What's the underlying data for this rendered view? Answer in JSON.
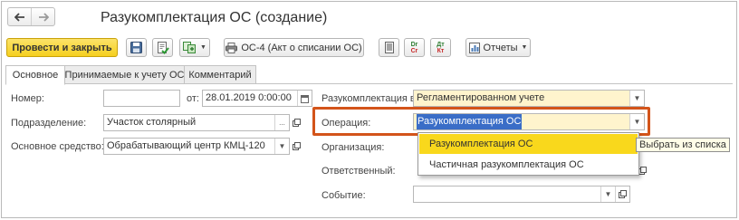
{
  "window": {
    "title": "Разукомплектация ОС (создание)"
  },
  "nav": {
    "back_icon": "arrow-left-icon",
    "forward_icon": "arrow-right-icon"
  },
  "toolbar": {
    "post_close_label": "Провести и закрыть",
    "save_icon": "floppy-disk-icon",
    "post_icon": "post-document-icon",
    "create_based_icon": "create-based-on-icon",
    "print_form_label": "ОС-4 (Акт о списании ОС)",
    "journal_icon": "journal-icon",
    "dt_kt_glyph": {
      "top": "Dr",
      "bottom": "Cr"
    },
    "dt_kt_ru_glyph": {
      "top": "Дт",
      "bottom": "Кт"
    },
    "reports_label": "Отчеты"
  },
  "tabs": [
    {
      "label": "Основное"
    },
    {
      "label": "Принимаемые к учету ОС"
    },
    {
      "label": "Комментарий"
    }
  ],
  "form": {
    "number_label": "Номер:",
    "number_value": "",
    "date_label": "от:",
    "date_value": "28.01.2019  0:00:00",
    "department_label": "Подразделение:",
    "department_value": "Участок столярный",
    "asset_label": "Основное средство:",
    "asset_value": "Обрабатывающий центр КМЦ-120",
    "disassembly_in_label": "Разукомплектация в:",
    "disassembly_in_value": "Регламентированном учете",
    "operation_label": "Операция:",
    "operation_value": "Разукомплектация ОС",
    "organization_label": "Организация:",
    "responsible_label": "Ответственный:",
    "event_label": "Событие:",
    "event_value": ""
  },
  "dropdown": {
    "items": [
      {
        "label": "Разукомплектация ОС"
      },
      {
        "label": "Частичная разукомплектация ОС"
      }
    ],
    "tooltip": "Выбрать из списка"
  },
  "colors": {
    "primary_button": "#f5cf1f",
    "highlight_border": "#d3541a",
    "selected_item": "#f9d81c",
    "text_selection": "#3a6dc7",
    "required_field": "#fff4cd"
  }
}
